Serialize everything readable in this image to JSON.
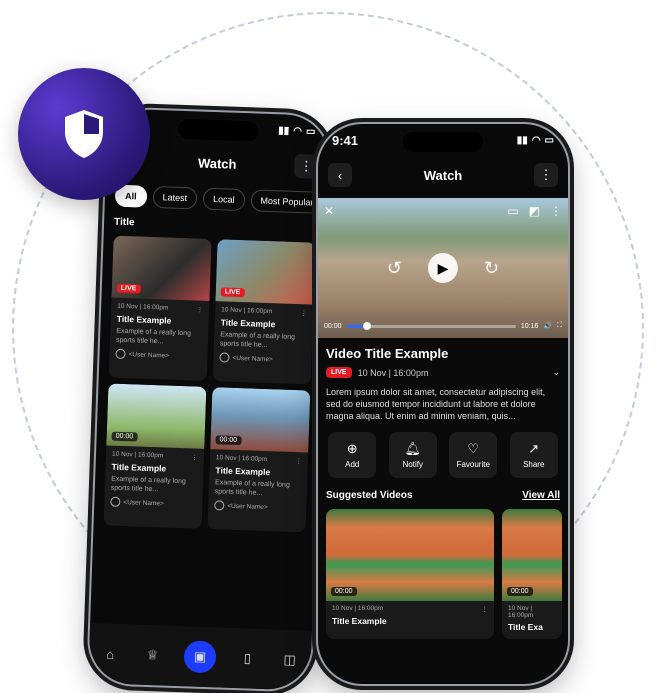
{
  "left_phone": {
    "topbar": {
      "title": "Watch"
    },
    "chips": [
      "All",
      "Latest",
      "Local",
      "Most Popular"
    ],
    "section_title": "Title",
    "cards": [
      {
        "badge": "LIVE",
        "meta": "10 Nov | 16:00pm",
        "title": "Title Example",
        "desc": "Example of a really long sports title he...",
        "user": "<User Name>"
      },
      {
        "badge": "LIVE",
        "meta": "10 Nov | 16:00pm",
        "title": "Title Example",
        "desc": "Example of a really long sports title he...",
        "user": "<User Name>"
      },
      {
        "badge": "00:00",
        "meta": "10 Nov | 16:00pm",
        "title": "Title Example",
        "desc": "Example of a really long sports title he...",
        "user": "<User Name>"
      },
      {
        "badge": "00:00",
        "meta": "10 Nov | 16:00pm",
        "title": "Title Example",
        "desc": "Example of a really long sports title he...",
        "user": "<User Name>"
      }
    ]
  },
  "right_phone": {
    "status": {
      "time": "9:41"
    },
    "topbar": {
      "title": "Watch"
    },
    "player": {
      "current_time": "00:00",
      "total_time": "10:16",
      "progress": 0.12
    },
    "video": {
      "title": "Video Title Example",
      "live": "LIVE",
      "date": "10 Nov | 16:00pm",
      "description": "Lorem ipsum dolor sit amet, consectetur adipiscing elit, sed do eiusmod tempor incididunt ut labore et dolore magna aliqua. Ut enim ad minim veniam, quis..."
    },
    "actions": [
      {
        "label": "Add",
        "icon": "plus-circle-icon"
      },
      {
        "label": "Notify",
        "icon": "bell-icon"
      },
      {
        "label": "Favourite",
        "icon": "heart-icon"
      },
      {
        "label": "Share",
        "icon": "share-icon"
      }
    ],
    "suggested": {
      "heading": "Suggested Videos",
      "view_all": "View All",
      "items": [
        {
          "duration": "00:00",
          "meta": "10 Nov | 16:00pm",
          "title": "Title Example"
        },
        {
          "duration": "00:00",
          "meta": "10 Nov | 16:00pm",
          "title": "Title Exa"
        }
      ]
    }
  },
  "colors": {
    "accent": "#1e3cff",
    "live": "#e31b23",
    "badge": "#3a1f9a"
  }
}
